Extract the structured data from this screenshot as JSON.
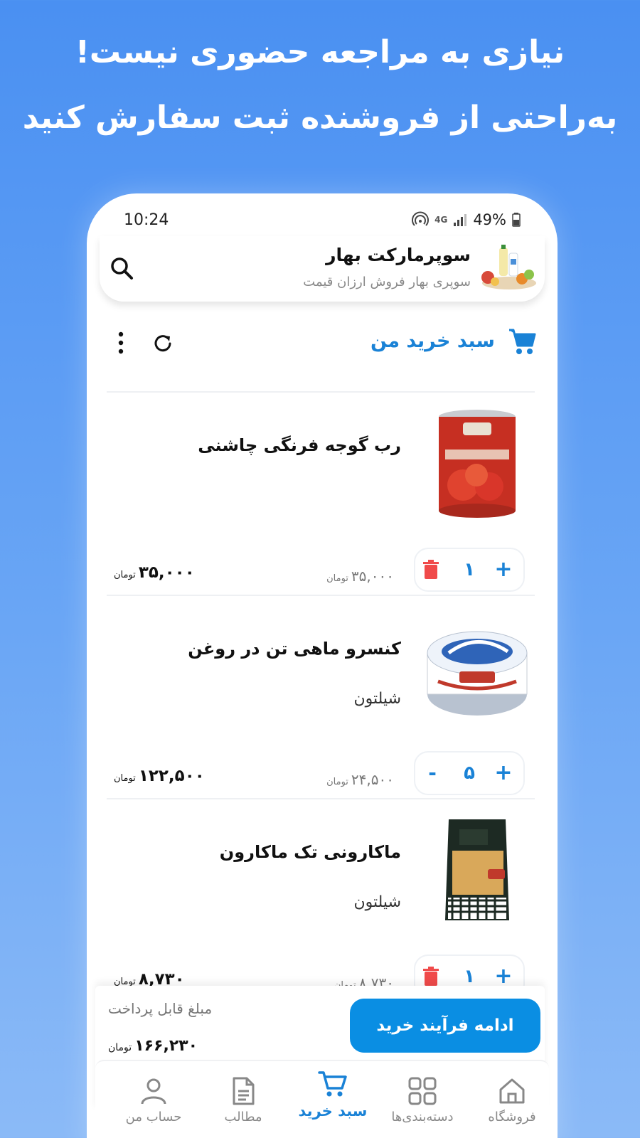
{
  "promo": {
    "line1": "نیازی به مراجعه حضوری نیست!",
    "line2": "به‌راحتی از فروشنده ثبت سفارش کنید"
  },
  "status_bar": {
    "time": "10:24",
    "network": "4G",
    "battery": "49%"
  },
  "store": {
    "name": "سوپرمارکت بهار",
    "tagline": "سوپری بهار فروش ارزان قیمت"
  },
  "cart": {
    "title": "سبد خرید من"
  },
  "currency": "تومان",
  "items": [
    {
      "name": "رب گوجه فرنگی چاشنی",
      "brand": "",
      "unit_price": "۳۵,۰۰۰",
      "quantity": "۱",
      "total": "۳۵,۰۰۰"
    },
    {
      "name": "کنسرو ماهی تن در روغن",
      "brand": "شیلتون",
      "unit_price": "۲۴,۵۰۰",
      "quantity": "۵",
      "total": "۱۲۲,۵۰۰"
    },
    {
      "name": "ماکارونی تک ماکارون",
      "brand": "شیلتون",
      "unit_price": "۸,۷۳۰",
      "quantity": "۱",
      "total": "۸,۷۳۰"
    }
  ],
  "checkout": {
    "label": "مبلغ قابل پرداخت",
    "total": "۱۶۶,۲۳۰",
    "button": "ادامه فرآیند خرید"
  },
  "nav": {
    "store": "فروشگاه",
    "categories": "دسته‌بندی‌ها",
    "cart": "سبد خرید",
    "articles": "مطالب",
    "account": "حساب من"
  },
  "colors": {
    "accent": "#1a82d6",
    "button": "#0a8ee3",
    "delete": "#f04a4a",
    "background": "#4a90f2"
  }
}
